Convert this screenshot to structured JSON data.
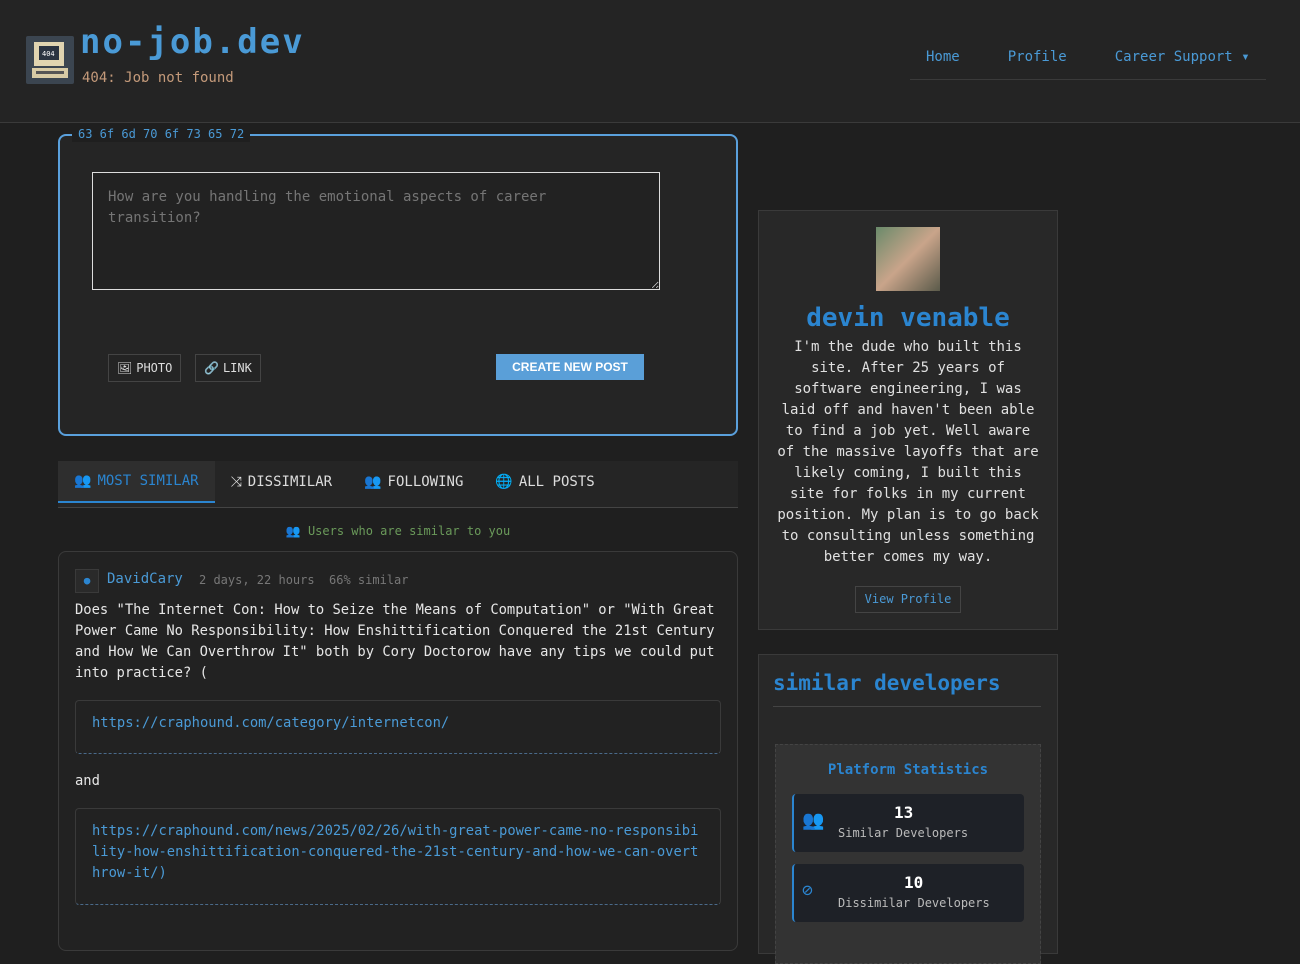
{
  "header": {
    "title": "no-job.dev",
    "tagline": "404: Job not found",
    "logo_text": "404",
    "nav": [
      {
        "label": "Home"
      },
      {
        "label": "Profile"
      },
      {
        "label": "Career Support"
      }
    ]
  },
  "composer": {
    "legend": "63 6f 6d 70 6f 73 65 72",
    "placeholder": "How are you handling the emotional aspects of career transition?",
    "photo": "PHOTO",
    "link": "LINK",
    "create": "CREATE NEW POST"
  },
  "tabs": [
    {
      "label": "MOST SIMILAR"
    },
    {
      "label": "DISSIMILAR"
    },
    {
      "label": "FOLLOWING"
    },
    {
      "label": "ALL POSTS"
    }
  ],
  "hint": "Users who are similar to you",
  "post": {
    "author": "DavidCary",
    "time": "2 days, 22 hours",
    "similarity": "66% similar",
    "text": "Does \"The Internet Con: How to Seize the Means of Computation\" or \"With Great Power Came No Responsibility: How Enshittification Conquered the 21st Century and How We Can Overthrow It\" both by Cory Doctorow have any tips we could put into practice? (",
    "link1": "https://craphound.com/category/internetcon/",
    "and": "and",
    "link2": "https://craphound.com/news/2025/02/26/with-great-power-came-no-responsibility-how-enshittification-conquered-the-21st-century-and-how-we-can-overthrow-it/)"
  },
  "profile": {
    "name": "devin venable",
    "bio": "I'm the dude who built this site. After 25 years of software engineering, I was laid off and haven't been able to find a job yet. Well aware of the massive layoffs that are likely coming, I built this site for folks in my current position. My plan is to go back to consulting unless something better comes my way.",
    "view": "View Profile"
  },
  "similar": {
    "title": "similar developers",
    "stats_title": "Platform Statistics",
    "stats": [
      {
        "value": "13",
        "label": "Similar Developers"
      },
      {
        "value": "10",
        "label": "Dissimilar Developers"
      }
    ]
  }
}
